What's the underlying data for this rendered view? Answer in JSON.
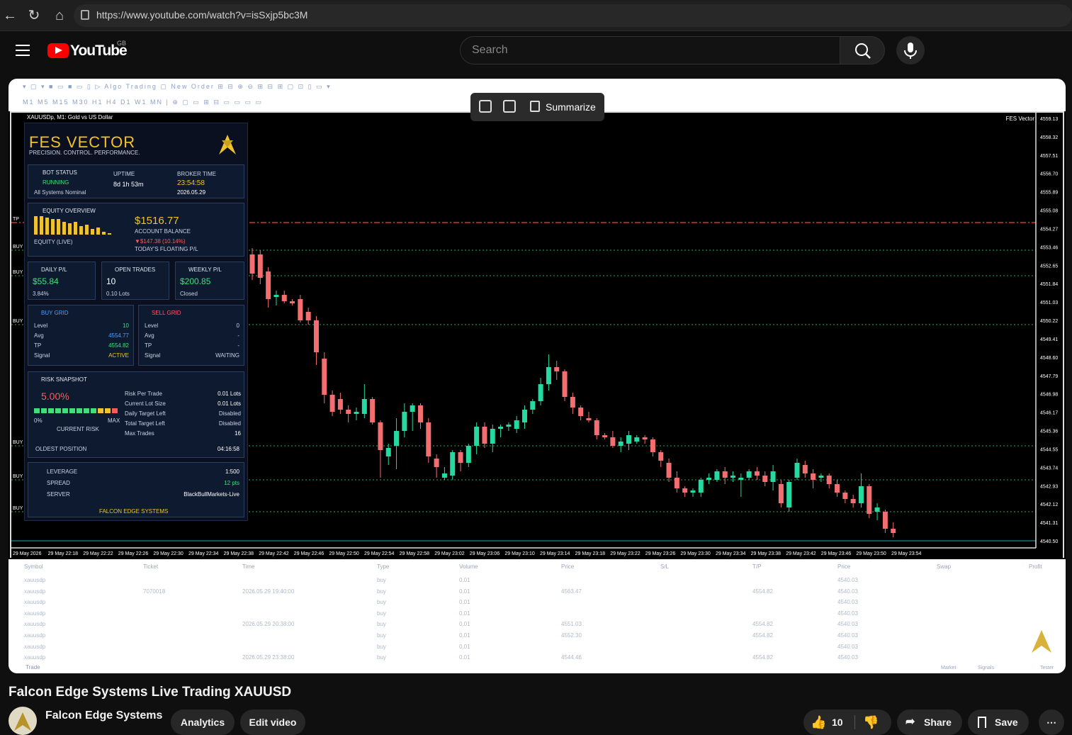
{
  "browser": {
    "url": "https://www.youtube.com/watch?v=isSxjp5bc3M"
  },
  "header": {
    "logo_text": "YouTube",
    "country_code": "GB",
    "search_placeholder": "Search"
  },
  "video": {
    "popup_label": "Summarize",
    "chart_title": "XAUUSDp, M1:  Gold vs US Dollar",
    "ea_name": "FES Vector",
    "panel": {
      "brand": "FES VECTOR",
      "tagline": "PRECISION. CONTROL. PERFORMANCE.",
      "bot_status_label": "BOT STATUS",
      "bot_status_value": "RUNNING",
      "bot_status_note": "All Systems Nominal",
      "uptime_label": "UPTIME",
      "uptime_value": "8d 1h 53m",
      "broker_time_label": "BROKER TIME",
      "broker_time_value": "23:54:58",
      "broker_date": "2026.05.29",
      "equity_label": "EQUITY OVERVIEW",
      "equity_sub": "EQUITY (LIVE)",
      "balance_value": "$1516.77",
      "balance_label": "ACCOUNT BALANCE",
      "floating_value": "▼$147.38 (10.14%)",
      "floating_label": "TODAY'S FLOATING P/L",
      "daily_label": "DAILY P/L",
      "daily_value": "$55.84",
      "daily_pct": "3.84%",
      "open_label": "OPEN TRADES",
      "open_value": "10",
      "open_lots": "0.10 Lots",
      "weekly_label": "WEEKLY P/L",
      "weekly_value": "$200.85",
      "weekly_status": "Closed",
      "buy_grid_label": "BUY GRID",
      "sell_grid_label": "SELL GRID",
      "grid_rows": [
        "Level",
        "Avg",
        "TP",
        "Signal"
      ],
      "buy_grid_values": [
        "10",
        "4554.77",
        "4554.82",
        "ACTIVE"
      ],
      "sell_grid_values": [
        "0",
        "-",
        "-",
        "WAITING"
      ],
      "risk_label": "RISK SNAPSHOT",
      "risk_pct": "5.00%",
      "risk_min": "0%",
      "risk_max": "MAX",
      "risk_caption": "CURRENT RISK",
      "risk_rows": [
        {
          "k": "Risk Per Trade",
          "v": "0.01 Lots"
        },
        {
          "k": "Current Lot Size",
          "v": "0.01 Lots"
        },
        {
          "k": "Daily Target Left",
          "v": "Disabled"
        },
        {
          "k": "Total Target Left",
          "v": "Disabled"
        },
        {
          "k": "Max Trades",
          "v": "16"
        }
      ],
      "oldest_label": "OLDEST POSITION",
      "oldest_value": "04:16:58",
      "leverage_label": "LEVERAGE",
      "leverage_value": "1:500",
      "spread_label": "SPREAD",
      "spread_value": "12 pts",
      "server_label": "SERVER",
      "server_value": "BlackBullMarkets-Live",
      "footer": "FALCON EDGE SYSTEMS"
    },
    "price_axis": [
      "4559.13",
      "4558.32",
      "4557.51",
      "4556.70",
      "4555.89",
      "4555.08",
      "4554.27",
      "4553.46",
      "4552.65",
      "4551.84",
      "4551.03",
      "4550.22",
      "4549.41",
      "4548.60",
      "4547.79",
      "4546.98",
      "4546.17",
      "4545.36",
      "4544.55",
      "4543.74",
      "4542.93",
      "4542.12",
      "4541.31",
      "4540.50"
    ],
    "time_axis": [
      "29 May 2026",
      "29 May 22:18",
      "29 May 22:22",
      "29 May 22:26",
      "29 May 22:30",
      "29 May 22:34",
      "29 May 22:38",
      "29 May 22:42",
      "29 May 22:46",
      "29 May 22:50",
      "29 May 22:54",
      "29 May 22:58",
      "29 May 23:02",
      "29 May 23:06",
      "29 May 23:10",
      "29 May 23:14",
      "29 May 23:18",
      "29 May 23:22",
      "29 May 23:26",
      "29 May 23:30",
      "29 May 23:34",
      "29 May 23:38",
      "29 May 23:42",
      "29 May 23:46",
      "29 May 23:50",
      "29 May 23:54"
    ],
    "terminal": {
      "headers": [
        "Symbol",
        "Ticket",
        "Time",
        "Type",
        "Volume",
        "Price",
        "S/L",
        "T/P",
        "Price",
        "Swap",
        "Profit"
      ],
      "rows": [
        [
          "xauusdp",
          "",
          "",
          "buy",
          "0.01",
          "",
          "",
          "",
          "4540.03",
          "",
          ""
        ],
        [
          "xauusdp",
          "7070018",
          "2026.05.29 19:40:00",
          "buy",
          "0.01",
          "4563.47",
          "",
          "4554.82",
          "4540.03",
          "",
          ""
        ],
        [
          "xauusdp",
          "",
          "",
          "buy",
          "0.01",
          "",
          "",
          "",
          "4540.03",
          "",
          ""
        ],
        [
          "xauusdp",
          "",
          "",
          "buy",
          "0.01",
          "",
          "",
          "",
          "4540.03",
          "",
          ""
        ],
        [
          "xauusdp",
          "",
          "2026.05.29 20:38:00",
          "buy",
          "0.01",
          "4551.03",
          "",
          "4554.82",
          "4540.03",
          "",
          ""
        ],
        [
          "xauusdp",
          "",
          "",
          "buy",
          "0.01",
          "4552.30",
          "",
          "4554.82",
          "4540.03",
          "",
          ""
        ],
        [
          "xauusdp",
          "",
          "",
          "buy",
          "0.01",
          "",
          "",
          "",
          "4540.03",
          "",
          ""
        ],
        [
          "xauusdp",
          "",
          "2026.05.29 23:38:00",
          "buy",
          "0.01",
          "4544.46",
          "",
          "4554.82",
          "4540.03",
          "",
          ""
        ]
      ],
      "tab_trade": "Trade",
      "tab_market": "Market",
      "tab_signals": "Signals",
      "tab_tester": "Tester"
    }
  },
  "meta": {
    "title": "Falcon Edge Systems Live Trading XAUUSD",
    "channel": "Falcon Edge Systems",
    "analytics": "Analytics",
    "edit_video": "Edit video",
    "likes": "10",
    "share": "Share",
    "save": "Save"
  },
  "chart_data": {
    "type": "candlestick",
    "title": "XAUUSDp, M1:  Gold vs US Dollar",
    "ylim": [
      4540.1,
      4559.5
    ],
    "horizontal_levels": [
      {
        "value": 4555.0,
        "style": "dash-dot",
        "color": "#e03030",
        "label": "TP"
      },
      {
        "value": 4553.7,
        "style": "dotted",
        "color": "#2ea86a",
        "label": "BUY"
      },
      {
        "value": 4552.5,
        "style": "dotted",
        "color": "#2ea86a",
        "label": "BUY"
      },
      {
        "value": 4550.2,
        "style": "dotted",
        "color": "#2ea86a",
        "label": "BUY"
      },
      {
        "value": 4544.5,
        "style": "dotted",
        "color": "#2ea86a",
        "label": "BUY"
      },
      {
        "value": 4542.9,
        "style": "dotted",
        "color": "#2ea86a",
        "label": "BUY"
      },
      {
        "value": 4541.4,
        "style": "dotted",
        "color": "#2ea86a",
        "label": "BUY"
      }
    ],
    "colors": {
      "up": "#26d9a0",
      "down": "#f36e70"
    },
    "candles": [
      [
        4553.5,
        4553.8,
        4552.3,
        4552.6
      ],
      [
        4553.5,
        4553.7,
        4552.1,
        4552.4
      ],
      [
        4552.7,
        4552.9,
        4551.0,
        4551.4
      ],
      [
        4551.5,
        4551.8,
        4551.1,
        4551.6
      ],
      [
        4551.6,
        4551.8,
        4551.2,
        4551.3
      ],
      [
        4551.3,
        4551.4,
        4551.1,
        4551.2
      ],
      [
        4551.4,
        4551.6,
        4550.3,
        4550.4
      ],
      [
        4550.8,
        4551.0,
        4550.2,
        4550.4
      ],
      [
        4550.4,
        4550.6,
        4548.3,
        4548.9
      ],
      [
        4548.6,
        4548.9,
        4546.5,
        4546.9
      ],
      [
        4546.9,
        4547.1,
        4545.9,
        4546.1
      ],
      [
        4546.7,
        4547.0,
        4546.0,
        4546.2
      ],
      [
        4546.2,
        4546.4,
        4545.6,
        4546.0
      ],
      [
        4546.0,
        4546.3,
        4545.7,
        4546.1
      ],
      [
        4546.0,
        4547.4,
        4545.8,
        4546.7
      ],
      [
        4546.7,
        4546.8,
        4545.5,
        4545.6
      ],
      [
        4545.6,
        4545.7,
        4543.0,
        4544.3
      ],
      [
        4544.0,
        4544.6,
        4543.6,
        4544.4
      ],
      [
        4544.5,
        4545.8,
        4543.4,
        4545.2
      ],
      [
        4545.2,
        4546.5,
        4544.9,
        4546.1
      ],
      [
        4546.1,
        4546.5,
        4545.2,
        4546.4
      ],
      [
        4546.4,
        4546.5,
        4545.3,
        4545.6
      ],
      [
        4545.6,
        4545.8,
        4543.7,
        4544.0
      ],
      [
        4543.9,
        4544.1,
        4543.0,
        4543.5
      ],
      [
        4543.0,
        4543.5,
        4542.9,
        4543.2
      ],
      [
        4543.1,
        4544.3,
        4542.9,
        4544.2
      ],
      [
        4544.2,
        4544.3,
        4543.3,
        4543.7
      ],
      [
        4543.7,
        4544.6,
        4543.5,
        4544.5
      ],
      [
        4544.5,
        4545.6,
        4544.1,
        4545.4
      ],
      [
        4545.4,
        4545.6,
        4544.4,
        4544.6
      ],
      [
        4544.6,
        4545.5,
        4544.2,
        4545.3
      ],
      [
        4545.3,
        4545.5,
        4544.9,
        4545.4
      ],
      [
        4545.4,
        4545.6,
        4545.2,
        4545.5
      ],
      [
        4545.3,
        4545.9,
        4545.1,
        4545.7
      ],
      [
        4545.6,
        4546.4,
        4545.3,
        4546.2
      ],
      [
        4546.2,
        4546.7,
        4546.0,
        4546.6
      ],
      [
        4546.6,
        4547.7,
        4546.4,
        4547.4
      ],
      [
        4547.4,
        4548.8,
        4547.1,
        4548.2
      ],
      [
        4548.2,
        4548.5,
        4547.6,
        4548.0
      ],
      [
        4548.0,
        4548.1,
        4546.6,
        4546.8
      ],
      [
        4546.8,
        4547.0,
        4546.0,
        4546.3
      ],
      [
        4546.3,
        4546.4,
        4545.7,
        4545.9
      ],
      [
        4545.8,
        4546.1,
        4545.6,
        4545.7
      ],
      [
        4545.7,
        4545.8,
        4544.8,
        4545.0
      ],
      [
        4545.0,
        4545.1,
        4544.8,
        4544.9
      ],
      [
        4544.9,
        4545.2,
        4544.4,
        4544.5
      ],
      [
        4544.5,
        4544.9,
        4544.2,
        4544.7
      ],
      [
        4544.6,
        4545.2,
        4544.3,
        4545.0
      ],
      [
        4544.7,
        4545.0,
        4544.6,
        4544.9
      ],
      [
        4544.9,
        4545.0,
        4544.6,
        4544.8
      ],
      [
        4544.8,
        4544.9,
        4544.0,
        4544.2
      ],
      [
        4544.2,
        4544.3,
        4543.5,
        4543.8
      ],
      [
        4543.7,
        4543.9,
        4542.8,
        4543.0
      ],
      [
        4543.0,
        4543.3,
        4542.3,
        4542.5
      ],
      [
        4542.5,
        4542.6,
        4542.1,
        4542.3
      ],
      [
        4542.3,
        4542.5,
        4542.1,
        4542.4
      ],
      [
        4542.3,
        4543.0,
        4542.1,
        4542.9
      ],
      [
        4542.9,
        4543.2,
        4542.7,
        4543.0
      ],
      [
        4542.9,
        4543.4,
        4542.8,
        4543.3
      ],
      [
        4543.3,
        4543.5,
        4542.7,
        4543.0
      ],
      [
        4543.0,
        4543.3,
        4542.8,
        4543.1
      ],
      [
        4542.9,
        4543.2,
        4542.1,
        4543.0
      ],
      [
        4543.0,
        4543.4,
        4542.9,
        4543.3
      ],
      [
        4543.3,
        4543.5,
        4542.9,
        4543.1
      ],
      [
        4543.1,
        4543.3,
        4542.6,
        4542.8
      ],
      [
        4542.8,
        4543.6,
        4542.4,
        4543.3
      ],
      [
        4542.7,
        4542.9,
        4541.6,
        4541.8
      ],
      [
        4541.6,
        4542.9,
        4541.4,
        4542.8
      ],
      [
        4543.0,
        4543.9,
        4542.9,
        4543.7
      ],
      [
        4543.6,
        4543.8,
        4543.0,
        4543.2
      ],
      [
        4543.2,
        4543.4,
        4542.5,
        4542.9
      ],
      [
        4543.0,
        4543.2,
        4542.8,
        4543.1
      ],
      [
        4543.1,
        4543.2,
        4542.5,
        4542.7
      ],
      [
        4542.7,
        4542.9,
        4542.1,
        4542.3
      ],
      [
        4542.3,
        4542.4,
        4541.8,
        4542.0
      ],
      [
        4542.0,
        4542.2,
        4541.6,
        4541.8
      ],
      [
        4541.8,
        4543.2,
        4541.6,
        4542.6
      ],
      [
        4542.6,
        4542.7,
        4541.1,
        4541.3
      ],
      [
        4541.4,
        4541.8,
        4541.0,
        4541.6
      ],
      [
        4541.4,
        4541.5,
        4540.4,
        4540.6
      ],
      [
        4540.6,
        4540.9,
        4540.2,
        4540.4
      ]
    ]
  }
}
